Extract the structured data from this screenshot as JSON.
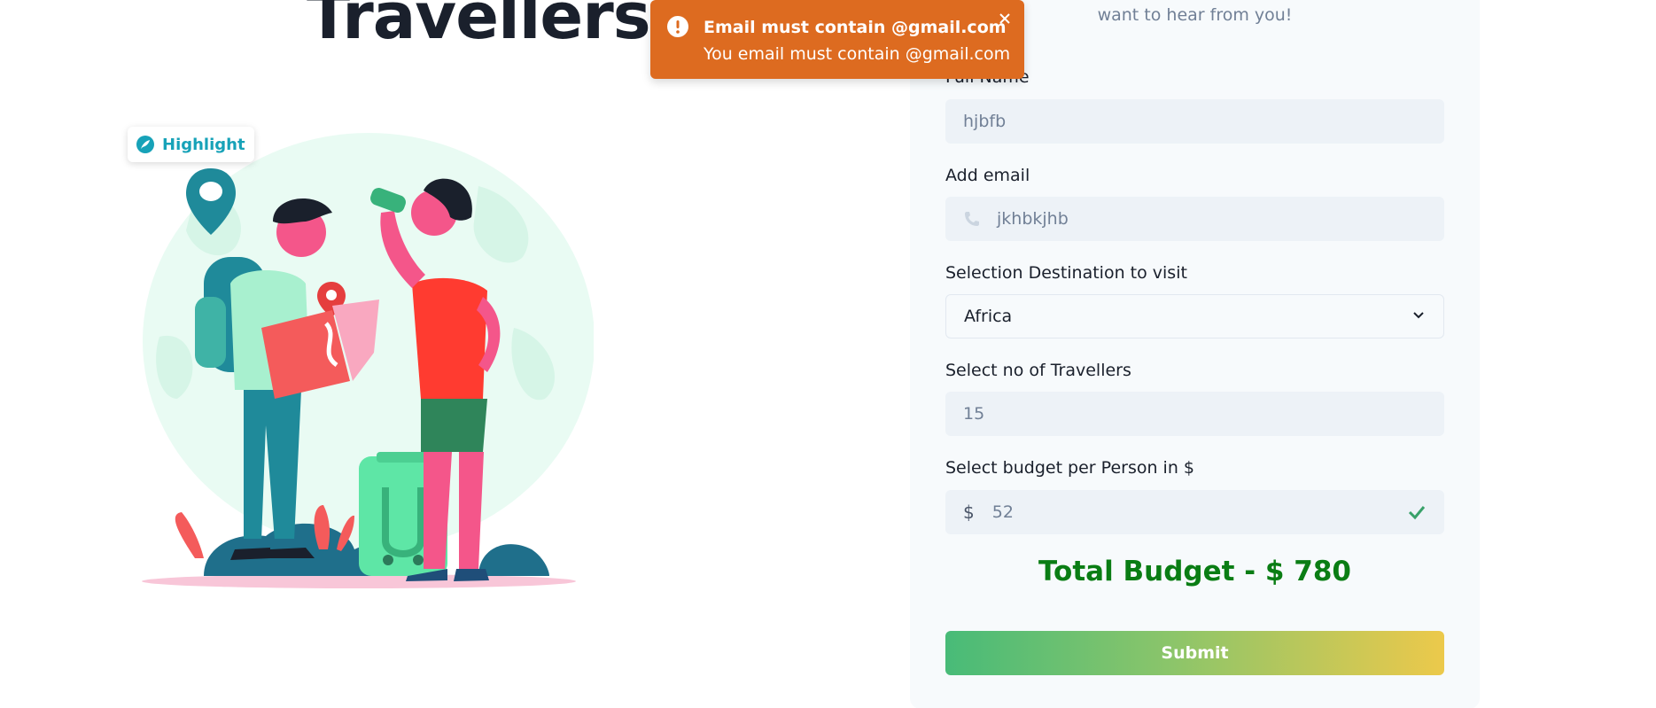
{
  "hero": {
    "title": "Travellers"
  },
  "highlight": {
    "label": "Highlight",
    "icon": "feather-icon",
    "color": "#17a2b8"
  },
  "form": {
    "intro": "want to hear from you!",
    "full_name": {
      "label": "Full Name",
      "value": "hjbfb"
    },
    "email": {
      "label": "Add email",
      "value": "jkhbkjhb",
      "icon": "phone-icon"
    },
    "destination": {
      "label": "Selection Destination to visit",
      "selected": "Africa",
      "icon": "chevron-down-icon"
    },
    "travellers": {
      "label": "Select no of Travellers",
      "value": "15"
    },
    "budget": {
      "label": "Select budget per Person in $",
      "prefix": "$",
      "value": "52",
      "icon": "check-icon"
    },
    "total": "Total Budget - $ 780",
    "submit_label": "Submit"
  },
  "toast": {
    "title": "Email must contain @gmail.com",
    "description": "You email must contain @gmail.com",
    "color": "#dd6b20",
    "icon": "warning-icon",
    "close_icon": "close-icon"
  },
  "colors": {
    "accent_green": "#0a7d14",
    "gradient_start": "#48bb78",
    "gradient_end": "#ecc94b",
    "check_green": "#38a169"
  }
}
